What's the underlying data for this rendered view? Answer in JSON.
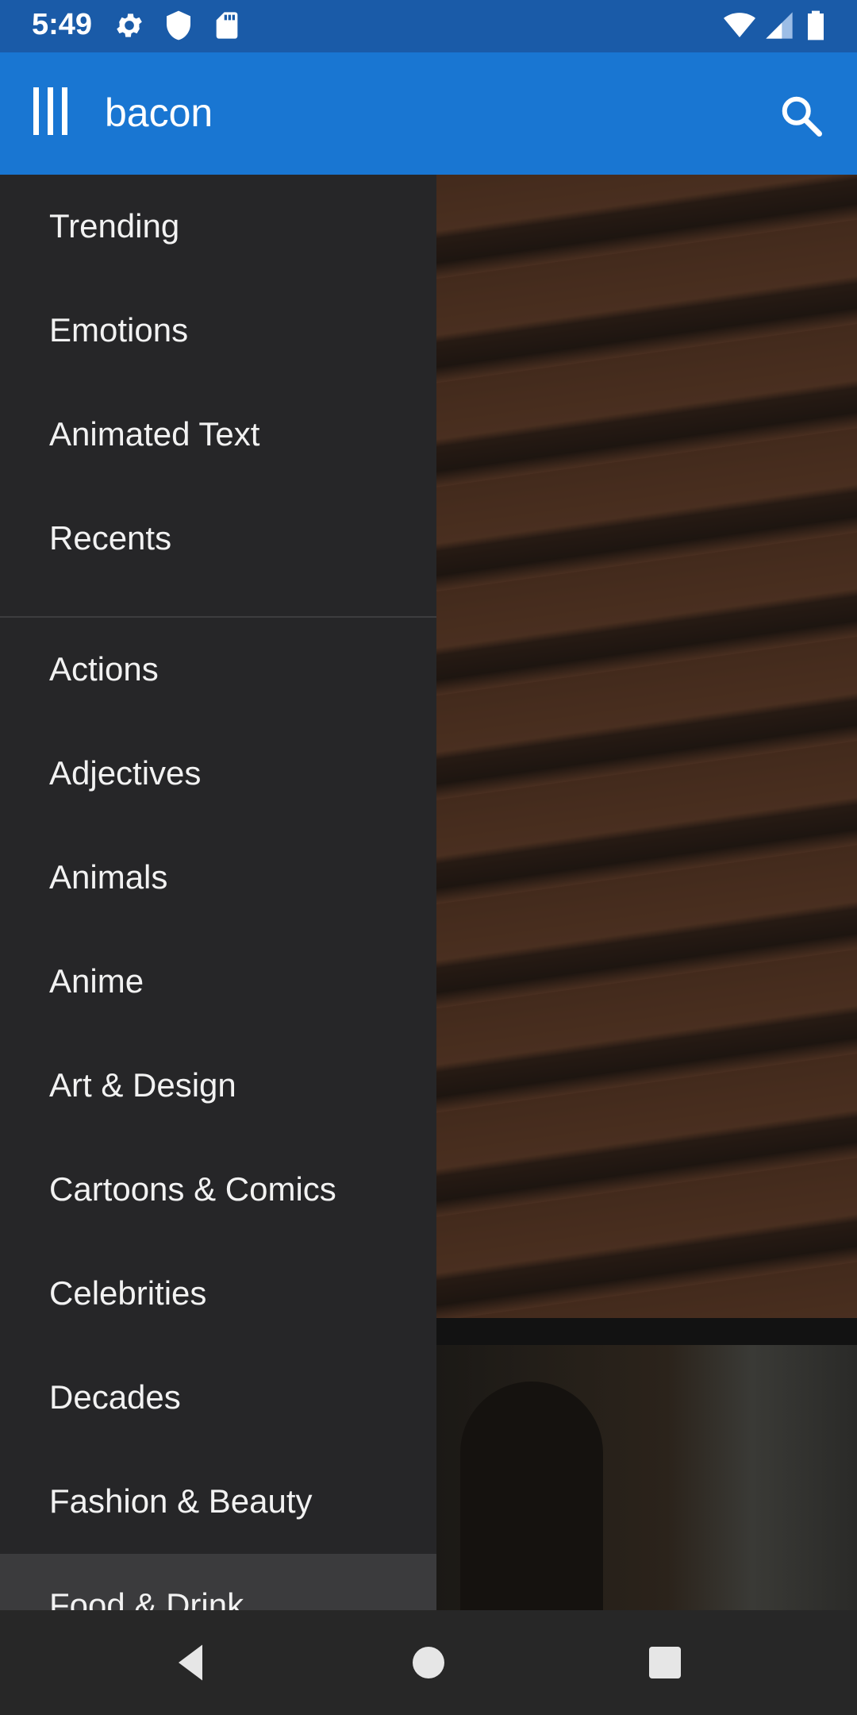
{
  "status_bar": {
    "time": "5:49",
    "left_icons": [
      "gear-icon",
      "shield-icon",
      "sd-card-icon"
    ],
    "right_icons": [
      "wifi-icon",
      "signal-icon",
      "battery-icon"
    ]
  },
  "app_bar": {
    "menu_icon": "menu-icon",
    "search_query": "bacon",
    "search_icon": "search-icon",
    "color": "#1976d2"
  },
  "drawer": {
    "group1": [
      "Trending",
      "Emotions",
      "Animated Text",
      "Recents"
    ],
    "group2": [
      "Actions",
      "Adjectives",
      "Animals",
      "Anime",
      "Art & Design",
      "Cartoons & Comics",
      "Celebrities",
      "Decades",
      "Fashion & Beauty",
      "Food & Drink"
    ],
    "selected": "Food & Drink",
    "background": "#262628"
  },
  "navigation_bar": {
    "buttons": [
      "back-icon",
      "home-icon",
      "recents-icon"
    ]
  }
}
